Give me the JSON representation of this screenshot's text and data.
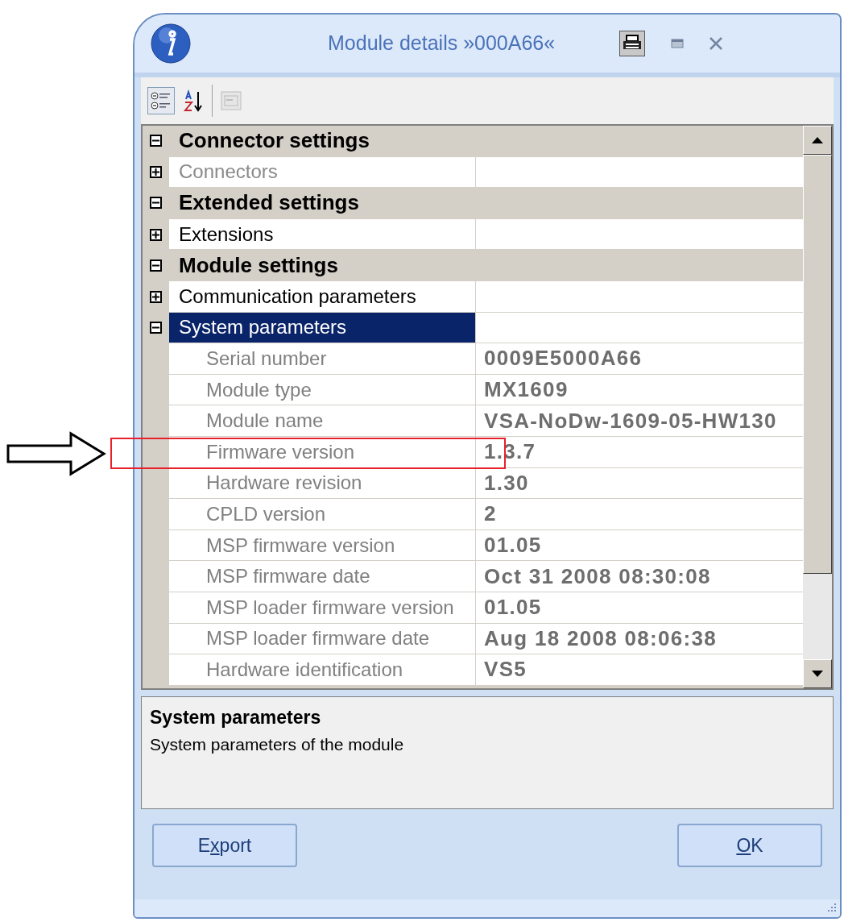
{
  "window": {
    "title": "Module details »000A66«"
  },
  "toolbar": [
    {
      "kind": "categorized",
      "selected": true,
      "disabled": false
    },
    {
      "kind": "alphabetical",
      "selected": false,
      "disabled": false
    },
    {
      "kind": "pages",
      "selected": false,
      "disabled": true
    }
  ],
  "categories": [
    {
      "name": "Connector settings",
      "expanded": true,
      "children": [
        {
          "name": "Connectors",
          "expanded": false,
          "disabled": true,
          "selected": false
        }
      ]
    },
    {
      "name": "Extended settings",
      "expanded": true,
      "children": [
        {
          "name": "Extensions",
          "expanded": false,
          "disabled": false,
          "selected": false
        }
      ]
    },
    {
      "name": "Module settings",
      "expanded": true,
      "children": [
        {
          "name": "Communication parameters",
          "expanded": false,
          "disabled": false,
          "selected": false
        },
        {
          "name": "System parameters",
          "expanded": true,
          "disabled": false,
          "selected": true,
          "children": [
            {
              "name": "Serial number",
              "value": "0009E5000A66",
              "selected": false
            },
            {
              "name": "Module type",
              "value": "MX1609",
              "selected": false
            },
            {
              "name": "Module name",
              "value": "VSA-NoDw-1609-05-HW130",
              "selected": false
            },
            {
              "name": "Firmware version",
              "value": "1.3.7",
              "selected": false
            },
            {
              "name": "Hardware revision",
              "value": "1.30",
              "selected": false
            },
            {
              "name": "CPLD version",
              "value": "2",
              "selected": false
            },
            {
              "name": "MSP firmware version",
              "value": "01.05",
              "selected": false
            },
            {
              "name": "MSP firmware date",
              "value": "Oct 31 2008 08:30:08",
              "selected": false
            },
            {
              "name": "MSP loader firmware version",
              "value": "01.05",
              "selected": false
            },
            {
              "name": "MSP loader firmware date",
              "value": "Aug 18 2008 08:06:38",
              "selected": false
            },
            {
              "name": "Hardware identification",
              "value": "VS5",
              "selected": false
            }
          ]
        }
      ]
    }
  ],
  "description": {
    "title": "System parameters",
    "text": "System parameters of the module"
  },
  "buttons": [
    {
      "label_parts": [
        {
          "text": "E",
          "underlined": false
        },
        {
          "text": "x",
          "underlined": true
        },
        {
          "text": "port",
          "underlined": false
        }
      ]
    },
    {
      "label_parts": [
        {
          "text": "O",
          "underlined": true
        },
        {
          "text": "K",
          "underlined": false
        }
      ]
    }
  ]
}
